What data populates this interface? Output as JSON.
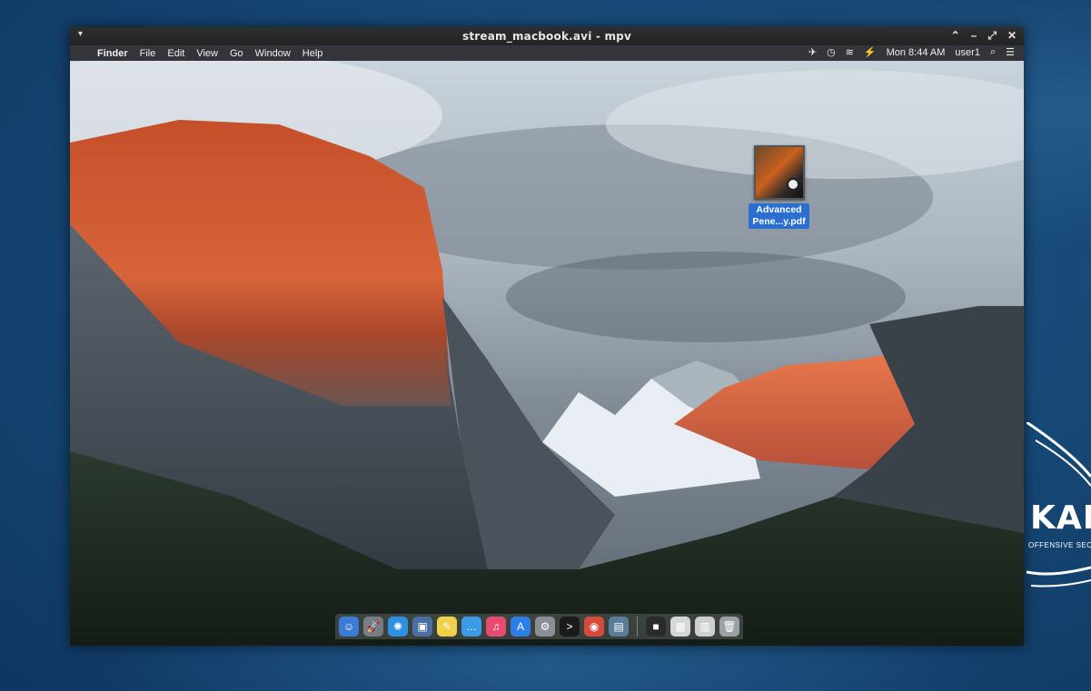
{
  "player": {
    "title": "stream_macbook.avi - mpv",
    "menu_glyph": "▾",
    "controls": [
      "⌃",
      "–",
      "⤢",
      "✕"
    ]
  },
  "menubar": {
    "apple_glyph": "",
    "items": [
      "Finder",
      "File",
      "Edit",
      "View",
      "Go",
      "Window",
      "Help"
    ],
    "clock": "Mon 8:44 AM",
    "user": "user1",
    "status_icons": [
      "volume-muted-icon",
      "time-machine-icon",
      "wifi-icon",
      "battery-icon",
      "spotlight-icon",
      "notification-center-icon"
    ],
    "status_glyphs": [
      "✈",
      "◷",
      "≋",
      "⚡",
      "⌕",
      "☰"
    ]
  },
  "desktop": {
    "file_label_line1": "Advanced",
    "file_label_line2": "Pene...y.pdf"
  },
  "dock": {
    "items": [
      {
        "name": "finder",
        "color": "#3a7bd5",
        "glyph": "☺"
      },
      {
        "name": "launchpad",
        "color": "#777d85",
        "glyph": "🚀"
      },
      {
        "name": "safari",
        "color": "#2f8fe0",
        "glyph": "✺"
      },
      {
        "name": "photos",
        "color": "#4a6fa0",
        "glyph": "▣"
      },
      {
        "name": "notes",
        "color": "#f2d04a",
        "glyph": "✎"
      },
      {
        "name": "messages",
        "color": "#3c9be6",
        "glyph": "…"
      },
      {
        "name": "itunes",
        "color": "#e94a6f",
        "glyph": "♫"
      },
      {
        "name": "app-store",
        "color": "#2c7ee8",
        "glyph": "A"
      },
      {
        "name": "system-preferences",
        "color": "#8a8f96",
        "glyph": "⚙"
      },
      {
        "name": "terminal",
        "color": "#1b1b1b",
        "glyph": ">"
      },
      {
        "name": "chrome",
        "color": "#d64a3b",
        "glyph": "◉"
      },
      {
        "name": "image-viewer",
        "color": "#5b7d9c",
        "glyph": "▤"
      },
      {
        "name": "screen-recorder",
        "color": "#2b2b2b",
        "glyph": "■"
      },
      {
        "name": "document",
        "color": "#d6d6d6",
        "glyph": "▦"
      },
      {
        "name": "preview",
        "color": "#cfcfcf",
        "glyph": "▥"
      },
      {
        "name": "trash",
        "color": "#9aa0a6",
        "glyph": "🗑"
      }
    ]
  },
  "brand": {
    "kali_text": "KALI",
    "kali_tagline": "OFFENSIVE SECURITY"
  }
}
